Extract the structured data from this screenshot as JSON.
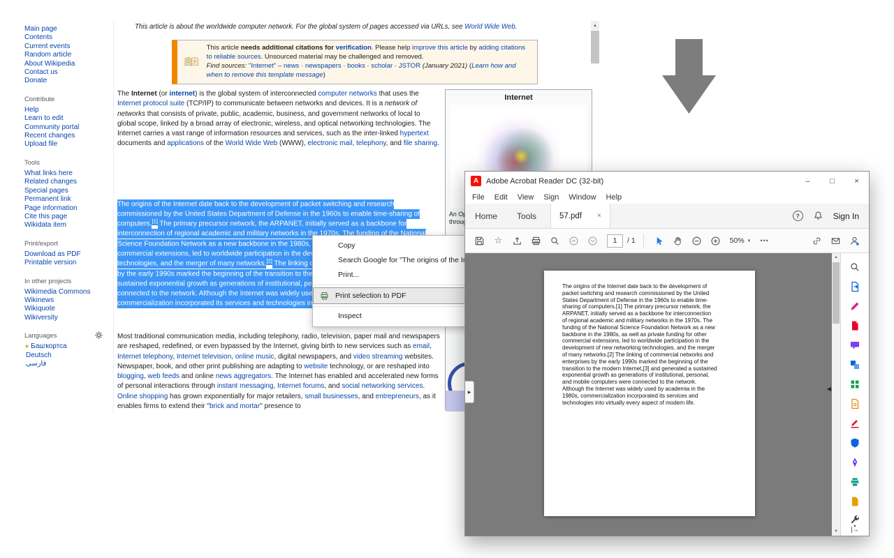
{
  "colors": {
    "wiki-link": "#0645ad",
    "selection": "#3d96f7",
    "banner-accent": "#f28500",
    "acrobat-red": "#fa0f00",
    "doc-gray": "#7b7b7b",
    "tool-blue": "#2a7ce0"
  },
  "icons": {
    "minimize": "–",
    "maximize": "□",
    "close": "×",
    "star": "☆",
    "more_dots": "•••",
    "caret_down": "▾",
    "help": "?",
    "scroll_up": "▲",
    "scroll_down": "▼",
    "panel_expand_right": "▶",
    "panel_collapse_left": "◀",
    "open_panel": "|→",
    "acrobat_logo": "A"
  },
  "wikipedia": {
    "sidebar": {
      "nav_items": [
        "Main page",
        "Contents",
        "Current events",
        "Random article",
        "About Wikipedia",
        "Contact us",
        "Donate"
      ],
      "sections": [
        {
          "title": "Contribute",
          "items": [
            "Help",
            "Learn to edit",
            "Community portal",
            "Recent changes",
            "Upload file"
          ]
        },
        {
          "title": "Tools",
          "items": [
            "What links here",
            "Related changes",
            "Special pages",
            "Permanent link",
            "Page information",
            "Cite this page",
            "Wikidata item"
          ]
        },
        {
          "title": "Print/export",
          "items": [
            "Download as PDF",
            "Printable version"
          ]
        },
        {
          "title": "In other projects",
          "items": [
            "Wikimedia Commons",
            "Wikinews",
            "Wikiquote",
            "Wikiversity"
          ]
        }
      ],
      "languages": {
        "title": "Languages",
        "items": [
          {
            "star": "★",
            "label": "Башҡортса"
          },
          {
            "star": "",
            "label": "Deutsch"
          },
          {
            "star": "",
            "label": "فارسی"
          }
        ]
      }
    },
    "hatnote": [
      {
        "t": "This article is about the worldwide computer network. For the global system of pages accessed via URLs, see "
      },
      {
        "t": "World Wide Web",
        "s": "a"
      },
      {
        "t": "."
      }
    ],
    "banner": {
      "main": [
        {
          "t": "This article "
        },
        {
          "t": "needs additional citations for",
          "s": "b"
        },
        {
          "t": " "
        },
        {
          "t": "verification",
          "s": "a b"
        },
        {
          "t": ". Please help "
        },
        {
          "t": "improve this article",
          "s": "a"
        },
        {
          "t": " by "
        },
        {
          "t": "adding citations to reliable sources",
          "s": "a"
        },
        {
          "t": ". Unsourced material may be challenged and removed."
        }
      ],
      "find_sources": [
        {
          "t": "Find sources:",
          "s": "i"
        },
        {
          "t": " "
        },
        {
          "t": "\"Internet\"",
          "s": "a"
        },
        {
          "t": " – "
        },
        {
          "t": "news",
          "s": "a"
        },
        {
          "t": " · "
        },
        {
          "t": "newspapers",
          "s": "a"
        },
        {
          "t": " · "
        },
        {
          "t": "books",
          "s": "a"
        },
        {
          "t": " · "
        },
        {
          "t": "scholar",
          "s": "a"
        },
        {
          "t": " · "
        },
        {
          "t": "JSTOR",
          "s": "a"
        },
        {
          "t": " "
        },
        {
          "t": "(January 2021)",
          "s": "i"
        },
        {
          "t": " ("
        },
        {
          "t": "Learn how and when to remove this template message",
          "s": "a i"
        },
        {
          "t": ")"
        }
      ]
    },
    "article": {
      "paragraph_intro": [
        {
          "t": "The "
        },
        {
          "t": "Internet",
          "s": "b"
        },
        {
          "t": " (or "
        },
        {
          "t": "internet",
          "s": "b a"
        },
        {
          "t": ") is the global system of interconnected "
        },
        {
          "t": "computer networks",
          "s": "a"
        },
        {
          "t": " that uses the "
        },
        {
          "t": "Internet protocol suite",
          "s": "a"
        },
        {
          "t": " (TCP/IP) to communicate between networks and devices. It is a "
        },
        {
          "t": "network of networks",
          "s": "i"
        },
        {
          "t": " that consists of private, public, academic, business, and government networks of local to global scope, linked by a broad array of electronic, wireless, and optical networking technologies. The Internet carries a vast range of information resources and services, such as the inter-linked "
        },
        {
          "t": "hypertext",
          "s": "a"
        },
        {
          "t": " documents and "
        },
        {
          "t": "applications",
          "s": "a"
        },
        {
          "t": " of the "
        },
        {
          "t": "World Wide Web",
          "s": "a"
        },
        {
          "t": " (WWW), "
        },
        {
          "t": "electronic mail",
          "s": "a"
        },
        {
          "t": ", "
        },
        {
          "t": "telephony",
          "s": "a"
        },
        {
          "t": ", and "
        },
        {
          "t": "file sharing",
          "s": "a"
        },
        {
          "t": "."
        }
      ],
      "paragraph_origins_selected": [
        {
          "t": "The origins of the Internet date back to the development of packet switching and research commissioned by the United States Department of Defense in the 1960s to enable time-sharing of computers."
        },
        {
          "t": "[1]",
          "s": "sup"
        },
        {
          "t": " The primary precursor network, the ARPANET, initially served as a backbone for interconnection of regional academic and military networks in the 1970s. The funding of the National Science Foundation Network as a new backbone in the 1980s, as well as private funding for other commercial extensions, led to worldwide participation in the development of new networking technologies, and the merger of many networks."
        },
        {
          "t": "[2]",
          "s": "sup"
        },
        {
          "t": " The linking of commercial networks and enterprises by the early 1990s marked the beginning of the transition to the modern Internet,"
        },
        {
          "t": "[3]",
          "s": "sup"
        },
        {
          "t": " and generated a sustained exponential growth as generations of institutional, personal, and mobile computers were connected to the network. Although the Internet was widely used by academia in the 1980s, commercialization incorporated its services and technologies into virtually every aspect of modern life."
        }
      ],
      "paragraph_media": [
        {
          "t": "Most traditional communication media, including telephony, radio, television, paper mail and newspapers are reshaped, redefined, or even bypassed by the Internet, giving birth to new services such as "
        },
        {
          "t": "email",
          "s": "a"
        },
        {
          "t": ", "
        },
        {
          "t": "Internet telephony",
          "s": "a"
        },
        {
          "t": ", "
        },
        {
          "t": "Internet television",
          "s": "a"
        },
        {
          "t": ", "
        },
        {
          "t": "online music",
          "s": "a"
        },
        {
          "t": ", digital newspapers, and "
        },
        {
          "t": "video streaming",
          "s": "a"
        },
        {
          "t": " websites. Newspaper, book, and other print publishing are adapting to "
        },
        {
          "t": "website",
          "s": "a"
        },
        {
          "t": " technology, or are reshaped into "
        },
        {
          "t": "blogging",
          "s": "a"
        },
        {
          "t": ", "
        },
        {
          "t": "web feeds",
          "s": "a"
        },
        {
          "t": " and online "
        },
        {
          "t": "news aggregators",
          "s": "a"
        },
        {
          "t": ". The Internet has enabled and accelerated new forms of personal interactions through "
        },
        {
          "t": "instant messaging",
          "s": "a"
        },
        {
          "t": ", "
        },
        {
          "t": "Internet forums",
          "s": "a"
        },
        {
          "t": ", and "
        },
        {
          "t": "social networking services",
          "s": "a"
        },
        {
          "t": ". "
        },
        {
          "t": "Online shopping",
          "s": "a"
        },
        {
          "t": " has grown exponentially for major retailers, "
        },
        {
          "t": "small businesses",
          "s": "a"
        },
        {
          "t": ", and "
        },
        {
          "t": "entrepreneurs",
          "s": "a"
        },
        {
          "t": ", as it enables firms to extend their \""
        },
        {
          "t": "brick and mortar",
          "s": "a"
        },
        {
          "t": "\" presence to"
        }
      ]
    },
    "infobox": {
      "title": "Internet",
      "caption": "An Opte Project visualization of routing paths through a portion of the Internet"
    }
  },
  "context_menu": {
    "items": [
      {
        "label": "Copy"
      },
      {
        "label": "Search Google for \"The origins of the Internet date"
      },
      {
        "label": "Print..."
      },
      {
        "label": "Print selection to PDF"
      },
      {
        "label": "Inspect"
      }
    ]
  },
  "acrobat": {
    "title": "Adobe Acrobat Reader DC (32-bit)",
    "menus": [
      "File",
      "Edit",
      "View",
      "Sign",
      "Window",
      "Help"
    ],
    "tabs": {
      "home": "Home",
      "tools": "Tools",
      "document": "57.pdf"
    },
    "sign_in": "Sign In",
    "toolbar": {
      "page_current": "1",
      "page_total": "/ 1",
      "zoom": "50%"
    },
    "pdf_text": "The origins of the Internet date back to the development of packet switching and research commissioned by the United States Department of Defense in the 1960s to enable time-sharing of computers.[1] The primary precursor network, the ARPANET, initially served as a backbone for interconnection of regional academic and military networks in the 1970s. The funding of the National Science Foundation Network as a new backbone in the 1980s, as well as private funding for other commercial extensions, led to worldwide participation in the development of new networking technologies, and the merger of many networks.[2] The linking of commercial networks and enterprises by the early 1990s marked the beginning of the transition to the modern Internet,[3] and generated a sustained exponential growth as generations of institutional, personal, and mobile computers were connected to the network. Although the Internet was widely used by academia in the 1980s, commercialization incorporated its services and technologies into virtually every aspect of modern life."
  }
}
